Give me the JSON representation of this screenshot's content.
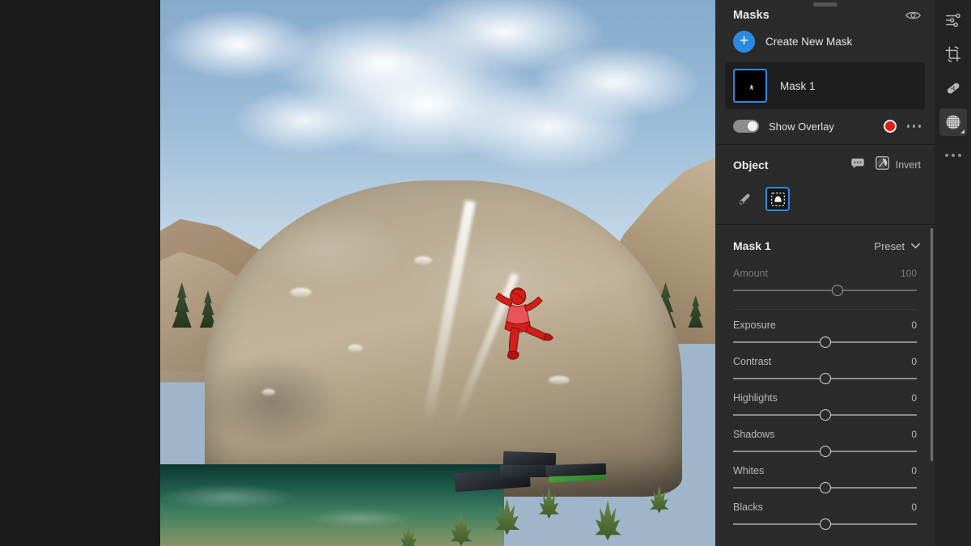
{
  "panel": {
    "masks_title": "Masks",
    "visibility_icon": "eye-icon",
    "create_new_mask": "Create New Mask",
    "plus_glyph": "+",
    "mask_list": [
      {
        "name": "Mask 1",
        "selected": true
      }
    ],
    "show_overlay_label": "Show Overlay",
    "show_overlay_on": true,
    "overlay_color": "#e41b13",
    "overlay_more_icon": "more-options-icon",
    "object": {
      "title": "Object",
      "comment_icon": "comment-bubble-icon",
      "invert_icon": "invert-icon",
      "invert_label": "Invert",
      "tools": [
        {
          "name": "brush-tool",
          "selected": false
        },
        {
          "name": "object-select-tool",
          "selected": true
        }
      ]
    },
    "mask_edit": {
      "title": "Mask 1",
      "preset_label": "Preset",
      "preset_chevron": "chevron-down-icon"
    },
    "sliders": [
      {
        "label": "Amount",
        "value": "100",
        "knob_pct": 57,
        "dim": true,
        "separator_after": true
      },
      {
        "label": "Exposure",
        "value": "0",
        "knob_pct": 50,
        "dim": false,
        "separator_after": false
      },
      {
        "label": "Contrast",
        "value": "0",
        "knob_pct": 50,
        "dim": false,
        "separator_after": false
      },
      {
        "label": "Highlights",
        "value": "0",
        "knob_pct": 50,
        "dim": false,
        "separator_after": false
      },
      {
        "label": "Shadows",
        "value": "0",
        "knob_pct": 50,
        "dim": false,
        "separator_after": false
      },
      {
        "label": "Whites",
        "value": "0",
        "knob_pct": 50,
        "dim": false,
        "separator_after": false
      },
      {
        "label": "Blacks",
        "value": "0",
        "knob_pct": 50,
        "dim": false,
        "separator_after": false
      }
    ]
  },
  "toolbar": {
    "items": [
      {
        "name": "edit-sliders-icon",
        "active": false
      },
      {
        "name": "crop-icon",
        "active": false
      },
      {
        "name": "healing-brush-icon",
        "active": false
      },
      {
        "name": "masking-icon",
        "active": true
      }
    ],
    "more_icon": "more-options-icon"
  },
  "canvas": {
    "image_alt": "Boulderer climbing a large sandstone boulder beside a green river in a canyon",
    "mask_overlay_color": "#e41b13"
  },
  "colors": {
    "accent_blue": "#2a8ae0",
    "panel_bg": "#2b2b2b",
    "toolbar_bg": "#232323",
    "canvas_bg": "#1b1b1b",
    "overlay_red": "#e41b13"
  }
}
